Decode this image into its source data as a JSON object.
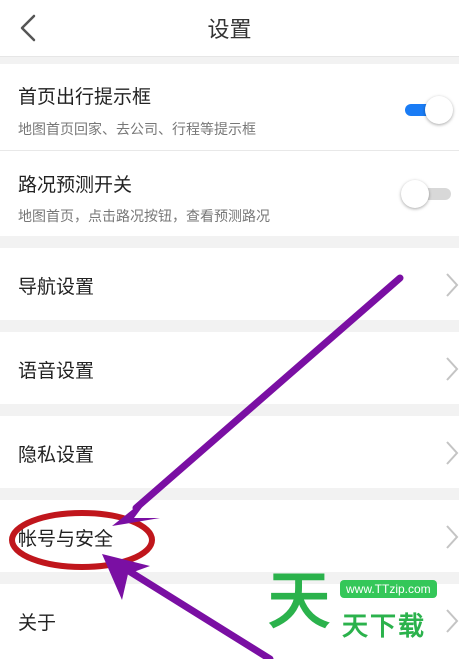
{
  "header": {
    "title": "设置",
    "back_icon": "chevron-left-icon"
  },
  "commute_prompt": {
    "title": "首页出行提示框",
    "subtitle": "地图首页回家、去公司、行程等提示框",
    "enabled": true
  },
  "traffic_prediction": {
    "title": "路况预测开关",
    "subtitle": "地图首页，点击路况按钮，查看预测路况",
    "enabled": false
  },
  "menu": {
    "navigation": "导航设置",
    "voice": "语音设置",
    "privacy": "隐私设置",
    "account": "帐号与安全",
    "about": "关于"
  },
  "colors": {
    "accent": "#1a7cf5",
    "annotation_arrow": "#7a0fa3",
    "annotation_circle": "#c0161c"
  },
  "watermark": {
    "url": "www.TTzip.com",
    "glyph": "天",
    "text": "天下载"
  }
}
